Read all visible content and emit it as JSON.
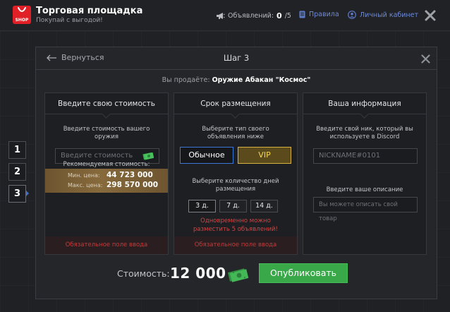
{
  "app": {
    "title": "Торговая площадка",
    "subtitle": "Покупай с выгодой!",
    "logo_text": "SHOP"
  },
  "topbar": {
    "ads_label": "Объявлений:",
    "ads_count": "0",
    "ads_max": "/5",
    "rules": "Правила",
    "cabinet": "Личный кабинет"
  },
  "steps": [
    "1",
    "2",
    "3"
  ],
  "modal": {
    "back": "Вернуться",
    "title": "Шаг 3",
    "selling_label": "Вы продаёте:",
    "item_name": "Оружие Абакан \"Космос\""
  },
  "price_panel": {
    "title": "Введите свою стоимость",
    "instruction": "Введите стоимость вашего оружия",
    "input_placeholder": "Введите стоимость",
    "recommended_label": "Рекомендуемая стоимость:",
    "min_label": "Мин. цена:",
    "min_value": "44 723 000",
    "max_label": "Макс. цена:",
    "max_value": "298 570 000",
    "required": "Обязательное поле ввода"
  },
  "term_panel": {
    "title": "Срок размещения",
    "type_instruction": "Выберите тип своего объявления ниже",
    "type_normal": "Обычное",
    "type_vip": "VIP",
    "days_instruction": "Выберите количество дней размещения",
    "days": [
      "3 д.",
      "7 д.",
      "14 д."
    ],
    "warning": "Одновременно можно разместить 5 объявлений!",
    "required": "Обязательное поле ввода"
  },
  "info_panel": {
    "title": "Ваша информация",
    "nick_instruction": "Введите свой ник, который вы используете в Discord",
    "nick_placeholder": "NICKNAME#0101",
    "desc_instruction": "Введите ваше описание",
    "desc_placeholder": "Вы можете описать свой товар"
  },
  "footer": {
    "cost_label": "Стоимость:",
    "cost_value": "12 000",
    "publish": "Опубликовать"
  },
  "colors": {
    "accent_blue": "#3a76d6",
    "vip_gold": "#d7b242",
    "publish_green": "#38a848",
    "error_red": "#c33c3c",
    "logo_red": "#e01f26"
  }
}
